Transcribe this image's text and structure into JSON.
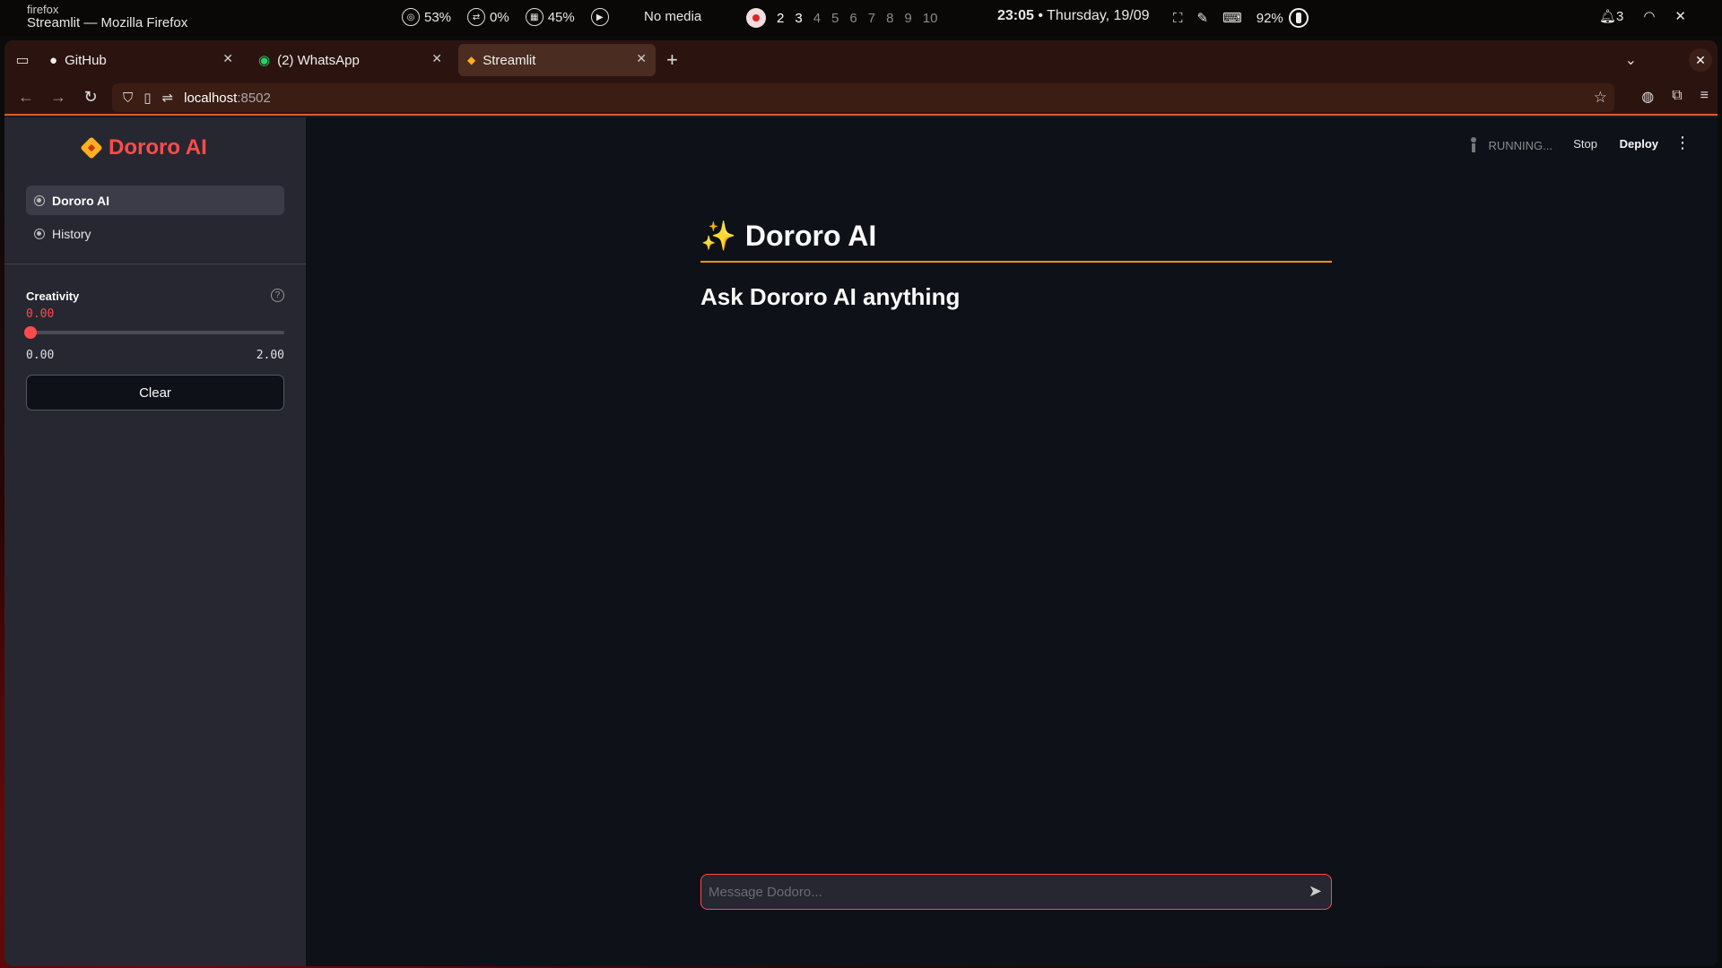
{
  "system_bar": {
    "app_small": "firefox",
    "window_title": "Streamlit — Mozilla Firefox",
    "cpu": "53%",
    "swap": "0%",
    "memory": "45%",
    "media": "No media",
    "workspaces": [
      "2",
      "3",
      "4",
      "5",
      "6",
      "7",
      "8",
      "9",
      "10"
    ],
    "time": "23:05",
    "date": " • Thursday, 19/09",
    "battery": "92%",
    "notifications": "3"
  },
  "browser": {
    "tabs": [
      {
        "label": "GitHub",
        "icon": "github-icon"
      },
      {
        "label": "(2) WhatsApp",
        "icon": "whatsapp-icon"
      },
      {
        "label": "Streamlit",
        "icon": "streamlit-icon"
      }
    ],
    "url_host": "localhost",
    "url_port": ":8502"
  },
  "sidebar": {
    "title": "Dororo AI",
    "nav": [
      {
        "label": "Dororo AI",
        "active": true
      },
      {
        "label": "History",
        "active": false
      }
    ],
    "slider": {
      "label": "Creativity",
      "value": "0.00",
      "min": "0.00",
      "max": "2.00",
      "fraction": 0.0
    },
    "clear_label": "Clear"
  },
  "header": {
    "running": "RUNNING...",
    "stop": "Stop",
    "deploy": "Deploy"
  },
  "main": {
    "title_emoji": "✨",
    "title": "Dororo AI",
    "subheader": "Ask Dororo AI anything",
    "chat_placeholder": "Message Dodoro..."
  },
  "colors": {
    "accent": "#ff4b4b",
    "title_underline": "#ff8c1a",
    "sidebar_bg": "#262730",
    "app_bg": "#0e1117"
  }
}
